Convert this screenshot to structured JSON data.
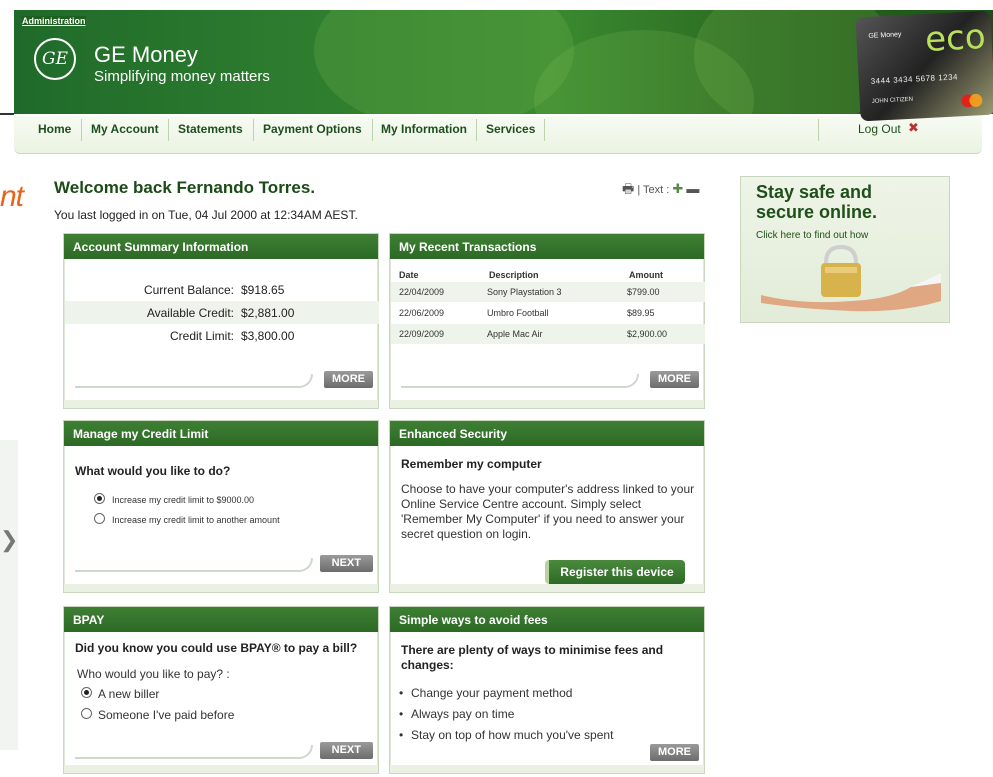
{
  "header": {
    "admin_link": "Administration",
    "logo_text": "GE",
    "brand": "GE Money",
    "tagline": "Simplifying money matters",
    "card": {
      "brand": "GE Money",
      "product": "eco",
      "number": "3444  3434  5678  1234",
      "name": "JOHN CITIZEN",
      "network": "MasterCard"
    }
  },
  "nav": {
    "items": [
      "Home",
      "My Account",
      "Statements",
      "Payment Options",
      "My Information",
      "Services"
    ],
    "logout": "Log Out"
  },
  "left_cutoff": {
    "text": "nt"
  },
  "welcome": {
    "title": "Welcome back Fernando Torres.",
    "last_login": "You last logged in on Tue, 04 Jul 2000 at 12:34AM AEST.",
    "text_size_label": "| Text :"
  },
  "account_summary": {
    "title": "Account Summary Information",
    "rows": [
      {
        "label": "Current Balance:",
        "value": "$918.65"
      },
      {
        "label": "Available Credit:",
        "value": "$2,881.00"
      },
      {
        "label": "Credit Limit:",
        "value": "$3,800.00"
      }
    ],
    "more": "MORE"
  },
  "recent_transactions": {
    "title": "My Recent Transactions",
    "columns": [
      "Date",
      "Description",
      "Amount"
    ],
    "rows": [
      [
        "22/04/2009",
        "Sony Playstation 3",
        "$799.00"
      ],
      [
        "22/06/2009",
        "Umbro Football",
        "$89.95"
      ],
      [
        "22/09/2009",
        "Apple Mac Air",
        "$2,900.00"
      ]
    ],
    "more": "MORE"
  },
  "credit_limit": {
    "title": "Manage my Credit Limit",
    "question": "What would you like to do?",
    "options": [
      "Increase my credit limit to $9000.00",
      "Increase my credit limit to another amount"
    ],
    "selected": 0,
    "next": "NEXT"
  },
  "security": {
    "title": "Enhanced Security",
    "subtitle": "Remember my computer",
    "body": "Choose to have your computer's address linked to your Online Service Centre account. Simply select 'Remember My Computer' if you need to answer your secret question on login.",
    "button": "Register this device"
  },
  "bpay": {
    "title": "BPAY",
    "question": "Did you know you could use BPAY® to pay a bill?",
    "prompt": "Who would you like to pay?   :",
    "options": [
      "A new biller",
      "Someone I've paid before"
    ],
    "selected": 0,
    "next": "NEXT"
  },
  "fees": {
    "title": "Simple ways to avoid fees",
    "intro": "There are plenty of ways to minimise fees and changes:",
    "tips": [
      "Change your payment method",
      "Always pay on time",
      "Stay on top of how much you've spent"
    ],
    "more": "MORE"
  },
  "ad": {
    "headline": "Stay safe and secure online.",
    "link": "Click here to find out how"
  },
  "colors": {
    "brand_green": "#2c6a25",
    "nav_text": "#1e4f1e",
    "accent_orange": "#e8641c"
  }
}
